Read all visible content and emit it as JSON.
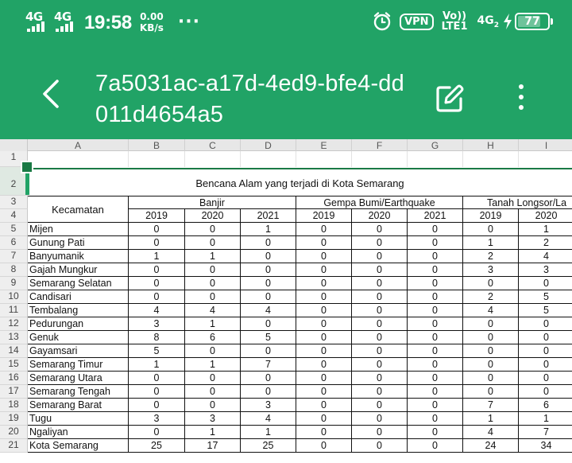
{
  "status_bar": {
    "network_1": "4G",
    "network_2": "4G",
    "time": "19:58",
    "speed_value": "0.00",
    "speed_unit": "KB/s",
    "more": "···",
    "vpn": "VPN",
    "volte_top": "Vo))",
    "volte_bottom": "LTE1",
    "network_3": "4G",
    "network_3_sub": "2",
    "battery": "77",
    "battery_level": 0.77
  },
  "app_bar": {
    "title": "7a5031ac-a17d-4ed9-bfe4-dd011d4654a5"
  },
  "sheet": {
    "columns": [
      "A",
      "B",
      "C",
      "D",
      "E",
      "F",
      "G",
      "H",
      "I"
    ],
    "row_numbers": [
      "1",
      "2",
      "3",
      "4",
      "5",
      "6",
      "7",
      "8",
      "9",
      "10",
      "11",
      "12",
      "13",
      "14",
      "15",
      "16",
      "17",
      "18",
      "19",
      "20",
      "21"
    ],
    "table_title": "Bencana Alam yang terjadi di Kota Semarang",
    "header_kecamatan": "Kecamatan",
    "group_banjir": "Banjir",
    "group_gempa": "Gempa Bumi/Earthquake",
    "group_longsor": "Tanah Longsor/La",
    "years": [
      "2019",
      "2020",
      "2021",
      "2019",
      "2020",
      "2021",
      "2019",
      "2020"
    ],
    "rows": [
      {
        "name": "Mijen",
        "values": [
          "0",
          "0",
          "1",
          "0",
          "0",
          "0",
          "0",
          "1"
        ]
      },
      {
        "name": "Gunung Pati",
        "values": [
          "0",
          "0",
          "0",
          "0",
          "0",
          "0",
          "1",
          "2"
        ]
      },
      {
        "name": "Banyumanik",
        "values": [
          "1",
          "1",
          "0",
          "0",
          "0",
          "0",
          "2",
          "4"
        ]
      },
      {
        "name": "Gajah Mungkur",
        "values": [
          "0",
          "0",
          "0",
          "0",
          "0",
          "0",
          "3",
          "3"
        ]
      },
      {
        "name": "Semarang Selatan",
        "values": [
          "0",
          "0",
          "0",
          "0",
          "0",
          "0",
          "0",
          "0"
        ]
      },
      {
        "name": "Candisari",
        "values": [
          "0",
          "0",
          "0",
          "0",
          "0",
          "0",
          "2",
          "5"
        ]
      },
      {
        "name": "Tembalang",
        "values": [
          "4",
          "4",
          "4",
          "0",
          "0",
          "0",
          "4",
          "5"
        ]
      },
      {
        "name": "Pedurungan",
        "values": [
          "3",
          "1",
          "0",
          "0",
          "0",
          "0",
          "0",
          "0"
        ]
      },
      {
        "name": "Genuk",
        "values": [
          "8",
          "6",
          "5",
          "0",
          "0",
          "0",
          "0",
          "0"
        ]
      },
      {
        "name": "Gayamsari",
        "values": [
          "5",
          "0",
          "0",
          "0",
          "0",
          "0",
          "0",
          "0"
        ]
      },
      {
        "name": "Semarang Timur",
        "values": [
          "1",
          "1",
          "7",
          "0",
          "0",
          "0",
          "0",
          "0"
        ]
      },
      {
        "name": "Semarang Utara",
        "values": [
          "0",
          "0",
          "0",
          "0",
          "0",
          "0",
          "0",
          "0"
        ]
      },
      {
        "name": "Semarang Tengah",
        "values": [
          "0",
          "0",
          "0",
          "0",
          "0",
          "0",
          "0",
          "0"
        ]
      },
      {
        "name": "Semarang Barat",
        "values": [
          "0",
          "0",
          "3",
          "0",
          "0",
          "0",
          "7",
          "6"
        ]
      },
      {
        "name": "Tugu",
        "values": [
          "3",
          "3",
          "4",
          "0",
          "0",
          "0",
          "1",
          "1"
        ]
      },
      {
        "name": "Ngaliyan",
        "values": [
          "0",
          "1",
          "1",
          "0",
          "0",
          "0",
          "4",
          "7"
        ]
      },
      {
        "name": "Kota Semarang",
        "values": [
          "25",
          "17",
          "25",
          "0",
          "0",
          "0",
          "24",
          "34"
        ]
      }
    ]
  }
}
